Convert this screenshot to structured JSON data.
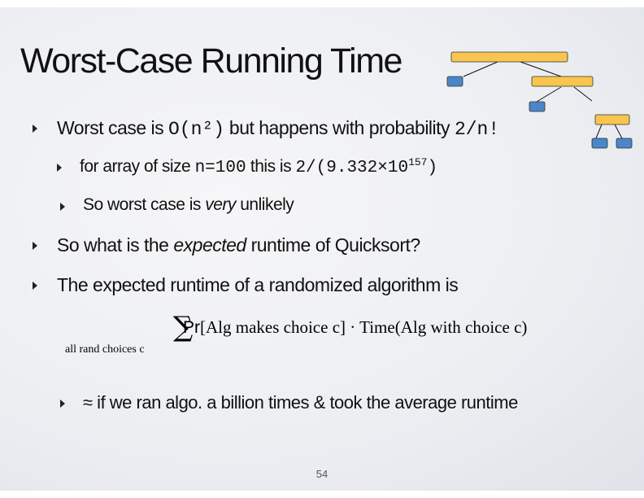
{
  "slide": {
    "title": "Worst-Case Running Time",
    "bullets": {
      "b1": {
        "pre": "Worst case is ",
        "code1": "O(n²)",
        "mid": " but happens with probability ",
        "code2": "2/n!"
      },
      "b1a": {
        "pre": "for array of size ",
        "code1": "n=100",
        "mid": " this is ",
        "code2": "2/(9.332×10",
        "sup": "157",
        "end": ")"
      },
      "b1b": {
        "pre": "So worst case is ",
        "em": "very",
        "post": " unlikely"
      },
      "b2": {
        "pre": "So what is the ",
        "em": "expected",
        "post": " runtime of Quicksort?"
      },
      "b3": {
        "text": "The expected runtime of a randomized algorithm is"
      },
      "b3a": {
        "text": "≈ if we ran algo. a billion times & took the average runtime"
      }
    },
    "formula": {
      "sigma": "∑",
      "sub": "all rand choices c",
      "pr": "Pr",
      "body": "[Alg makes choice c] · Time(Alg with choice c)"
    },
    "page_number": "54",
    "colors": {
      "node_yellow": "#f8c64e",
      "node_blue": "#4a86c8"
    }
  }
}
